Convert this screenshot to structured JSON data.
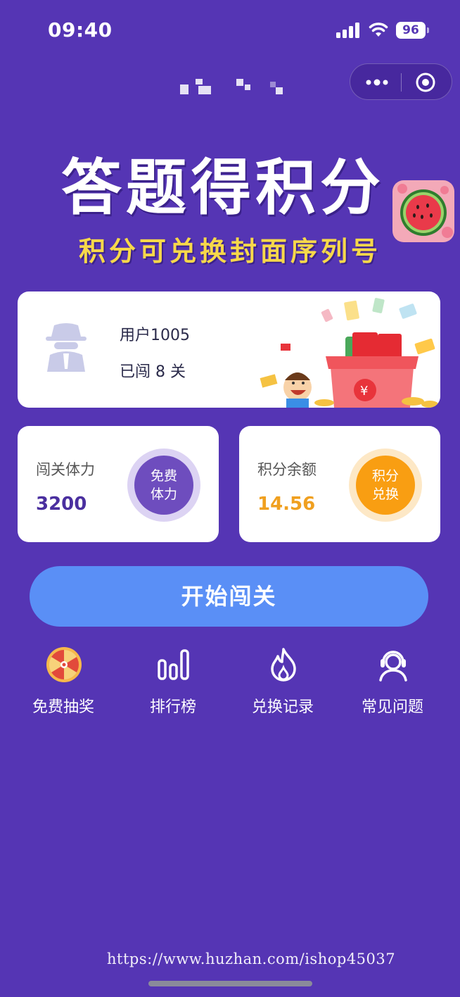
{
  "status_bar": {
    "time": "09:40",
    "battery": "96"
  },
  "banner": {
    "title": "答题得积分",
    "subtitle": "积分可兑换封面序列号"
  },
  "user": {
    "name": "用户1005",
    "level_text": "已闯 8 关"
  },
  "stamina": {
    "label": "闯关体力",
    "value": "3200",
    "button_line1": "免费",
    "button_line2": "体力"
  },
  "points": {
    "label": "积分余额",
    "value": "14.56",
    "button_line1": "积分",
    "button_line2": "兑换"
  },
  "start_button": "开始闯关",
  "quick_actions": [
    {
      "label": "免费抽奖",
      "icon": "prize-wheel-icon"
    },
    {
      "label": "排行榜",
      "icon": "bar-chart-icon"
    },
    {
      "label": "兑换记录",
      "icon": "flame-icon"
    },
    {
      "label": "常见问题",
      "icon": "headset-icon"
    }
  ],
  "watermark": "https://www.huzhan.com/ishop45037",
  "colors": {
    "background": "#5535b4",
    "accent_blue": "#5a8ff6",
    "orange": "#f99e12",
    "purple": "#6e4dbe",
    "subtitle_yellow": "#f7d84a"
  }
}
